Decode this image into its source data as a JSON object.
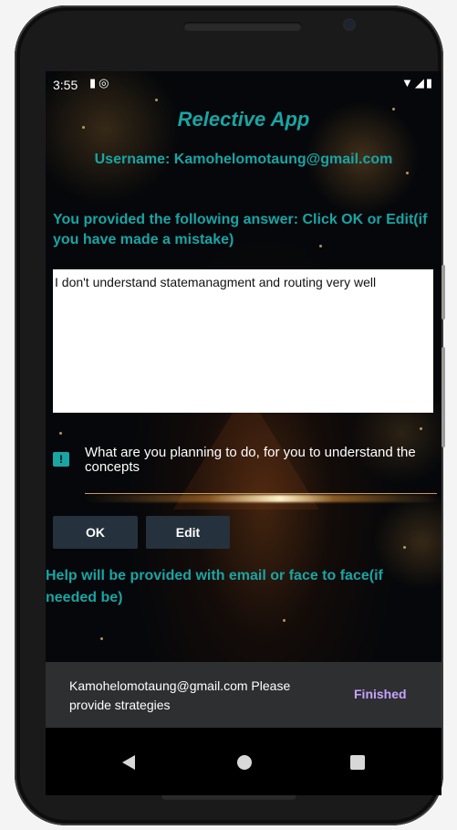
{
  "status_bar": {
    "time": "3:55",
    "left_icons": "▮◎",
    "right_icons": "▼◢▮"
  },
  "app": {
    "title": "Relective App",
    "username_line": "Username: Kamohelomotaung@gmail.com"
  },
  "answer_section": {
    "prompt": "You provided the following answer: Click OK or Edit(if you have made a mistake)",
    "answer_value": "I don't understand statemanagment and routing very well"
  },
  "plan_field": {
    "label": "What are you planning to do, for you to understand the concepts",
    "icon": "feedback-icon"
  },
  "buttons": {
    "ok_label": "OK",
    "edit_label": "Edit"
  },
  "help_text": "Help will be provided with email or face to face(if needed be)",
  "snackbar": {
    "message": "Kamohelomotaung@gmail.com Please provide strategies",
    "action_label": "Finished"
  },
  "colors": {
    "accent": "#1aa4a4",
    "button_bg": "#25313c",
    "snackbar_bg": "#2e2f31",
    "snackbar_action": "#c5a3ff"
  }
}
